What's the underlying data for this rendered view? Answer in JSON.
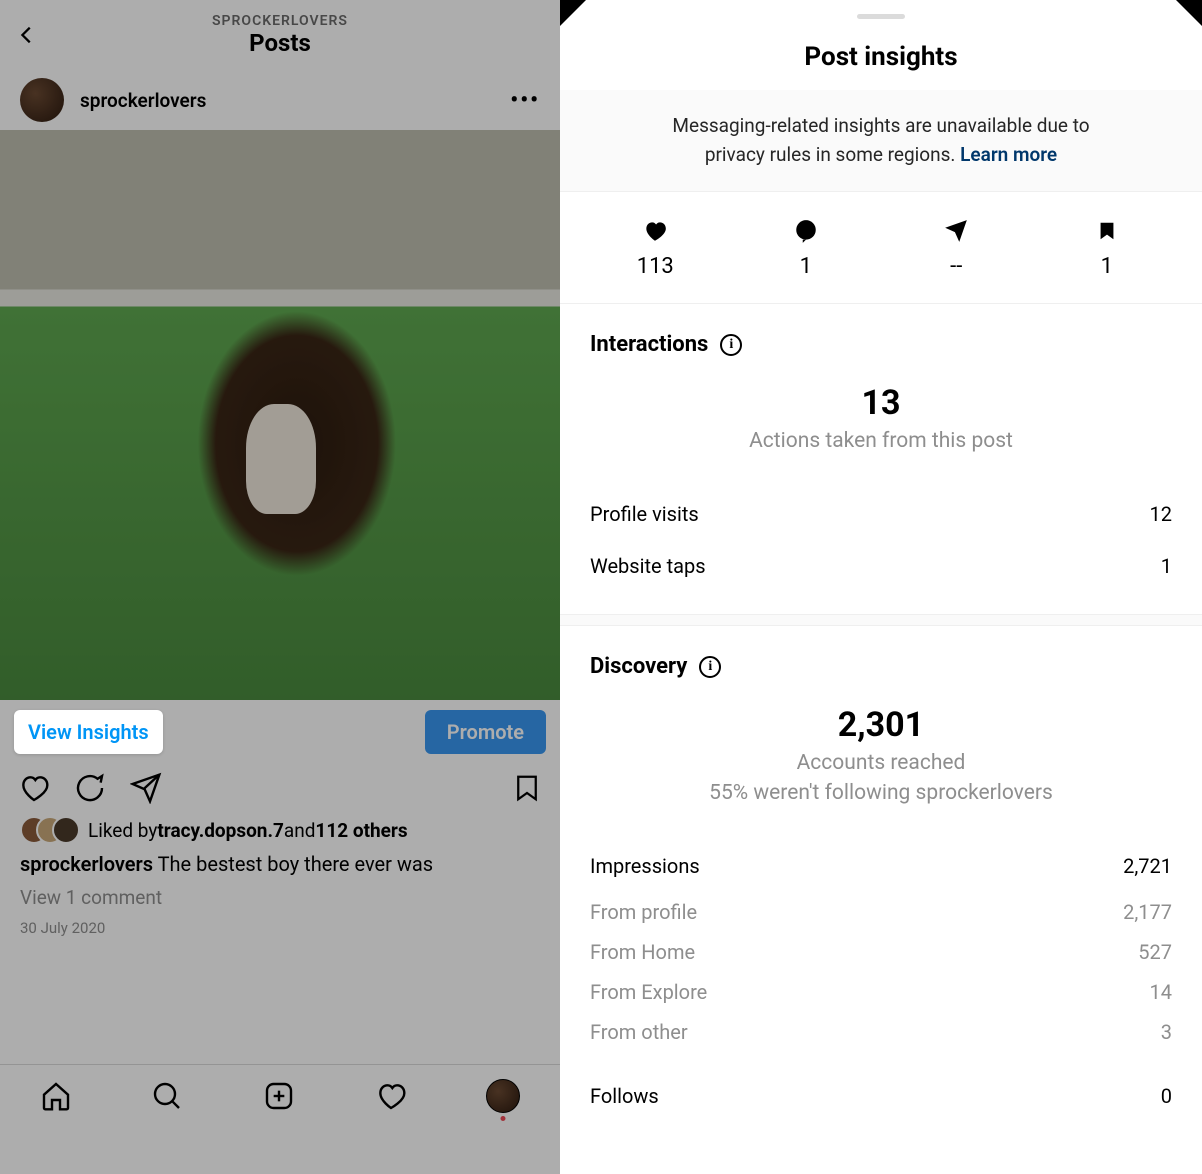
{
  "leftPanel": {
    "headerSub": "SPROCKERLOVERS",
    "headerTitle": "Posts",
    "username": "sprockerlovers",
    "viewInsights": "View Insights",
    "promote": "Promote",
    "likedByPrefix": "Liked by ",
    "likedByUser": "tracy.dopson.7",
    "likedByMid": " and ",
    "likedByOthers": "112 others",
    "captionUser": "sprockerlovers",
    "captionText": " The bestest boy there ever was",
    "viewComments": "View 1 comment",
    "postDate": "30 July 2020"
  },
  "rightPanel": {
    "title": "Post insights",
    "noticeLine1": "Messaging-related insights are unavailable due to",
    "noticeLine2": "privacy rules in some regions. ",
    "learnMore": "Learn more",
    "stats": {
      "likes": "113",
      "comments": "1",
      "shares": "--",
      "saves": "1"
    },
    "interactions": {
      "title": "Interactions",
      "bigNum": "13",
      "bigSub": "Actions taken from this post",
      "rows": [
        {
          "label": "Profile visits",
          "value": "12"
        },
        {
          "label": "Website taps",
          "value": "1"
        }
      ]
    },
    "discovery": {
      "title": "Discovery",
      "bigNum": "2,301",
      "bigSub1": "Accounts reached",
      "bigSub2": "55% weren't following sprockerlovers",
      "impressionsLabel": "Impressions",
      "impressionsValue": "2,721",
      "breakdown": [
        {
          "label": "From profile",
          "value": "2,177"
        },
        {
          "label": "From Home",
          "value": "527"
        },
        {
          "label": "From Explore",
          "value": "14"
        },
        {
          "label": "From other",
          "value": "3"
        }
      ],
      "followsLabel": "Follows",
      "followsValue": "0"
    }
  }
}
